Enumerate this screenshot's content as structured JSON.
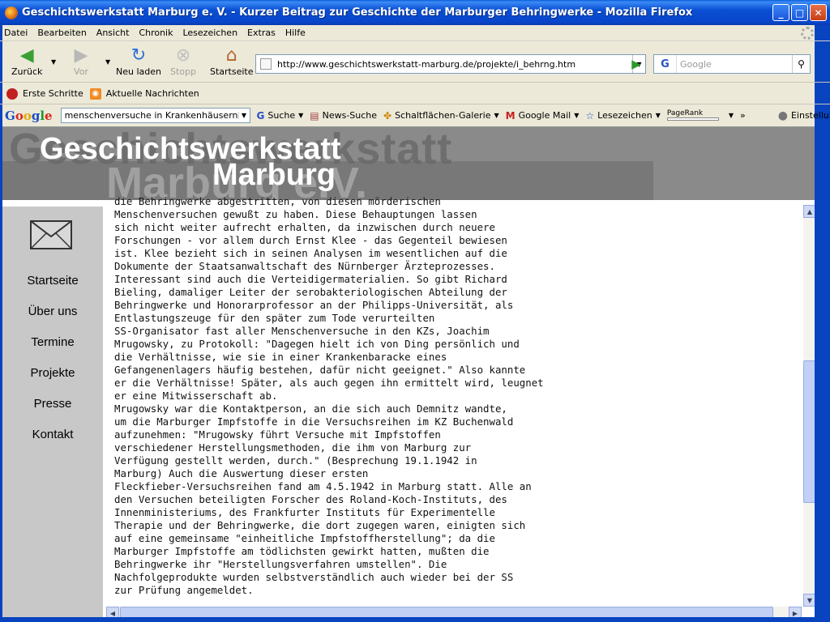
{
  "window": {
    "title": "Geschichtswerkstatt Marburg e. V. - Kurzer Beitrag zur Geschichte der Marburger Behringwerke - Mozilla Firefox",
    "minimize": "_",
    "maximize": "□",
    "close": "✕"
  },
  "menu": [
    "Datei",
    "Bearbeiten",
    "Ansicht",
    "Chronik",
    "Lesezeichen",
    "Extras",
    "Hilfe"
  ],
  "nav": {
    "back": "Zurück",
    "forward": "Vor",
    "reload": "Neu laden",
    "stop": "Stopp",
    "home": "Startseite",
    "url": "http://www.geschichtswerkstatt-marburg.de/projekte/i_behrng.htm",
    "search_placeholder": "Google"
  },
  "bookmarks": [
    "Erste Schritte",
    "Aktuelle Nachrichten"
  ],
  "google_toolbar": {
    "logo": "Google",
    "query": "menschenversuche in Krankenhäusern",
    "search": "Suche",
    "news": "News-Suche",
    "gallery": "Schaltflächen-Galerie",
    "gmail": "Google Mail",
    "bookmarks": "Lesezeichen",
    "pagerank": "PageRank",
    "more": "»",
    "settings": "Einstellungen"
  },
  "site": {
    "banner_line1": "Geschichtswerkstatt",
    "banner_line2": "Marburg",
    "banner_ghost1": "Geschichtswerkstatt",
    "banner_ghost2": "Marburg e.V.",
    "nav": [
      "Startseite",
      "Über uns",
      "Termine",
      "Projekte",
      "Presse",
      "Kontakt"
    ]
  },
  "article": {
    "lines": [
      "die Behringwerke abgestritten, von diesen mörderischen",
      "Menschenversuchen gewußt zu haben. Diese Behauptungen lassen",
      "sich nicht weiter aufrecht erhalten, da inzwischen durch neuere",
      "Forschungen - vor allem durch Ernst Klee - das Gegenteil bewiesen",
      "ist. Klee bezieht sich in seinen Analysen im wesentlichen auf die",
      "Dokumente der Staatsanwaltschaft des Nürnberger Ärzteprozesses.",
      "Interessant sind auch die Verteidigermaterialien. So gibt Richard",
      "Bieling, damaliger Leiter der serobakteriologischen Abteilung der",
      "Behringwerke und Honorarprofessor an der Philipps-Universität, als",
      "Entlastungszeuge für den später zum Tode verurteilten",
      "SS-Organisator fast aller Menschenversuche in den KZs, Joachim",
      "Mrugowsky, zu Protokoll: \"Dagegen hielt ich von Ding persönlich und",
      "die Verhältnisse, wie sie in einer Krankenbaracke eines",
      "Gefangenenlagers häufig bestehen, dafür nicht geeignet.\" Also kannte",
      "er die Verhältnisse! Später, als auch gegen ihn ermittelt wird, leugnet",
      "er eine Mitwisserschaft ab.",
      "Mrugowsky war die Kontaktperson, an die sich auch Demnitz wandte,",
      "um die Marburger Impfstoffe in die Versuchsreihen im KZ Buchenwald",
      "aufzunehmen: \"Mrugowsky führt Versuche mit Impfstoffen",
      "verschiedener Herstellungsmethoden, die ihm von Marburg zur",
      "Verfügung gestellt werden, durch.\" (Besprechung 19.1.1942 in",
      "Marburg) Auch die Auswertung dieser ersten",
      "Fleckfieber-Versuchsreihen fand am 4.5.1942 in Marburg statt. Alle an",
      "den Versuchen beteiligten Forscher des Roland-Koch-Instituts, des",
      "Innenministeriums, des Frankfurter Instituts für Experimentelle",
      "Therapie und der Behringwerke, die dort zugegen waren, einigten sich",
      "auf eine gemeinsame \"einheitliche Impfstoffherstellung\"; da die",
      "Marburger Impfstoffe am tödlichsten gewirkt hatten, mußten die",
      "Behringwerke ihr \"Herstellungsverfahren umstellen\". Die",
      "Nachfolgeprodukte wurden selbstverständlich auch wieder bei der SS",
      "zur Prüfung angemeldet."
    ]
  }
}
